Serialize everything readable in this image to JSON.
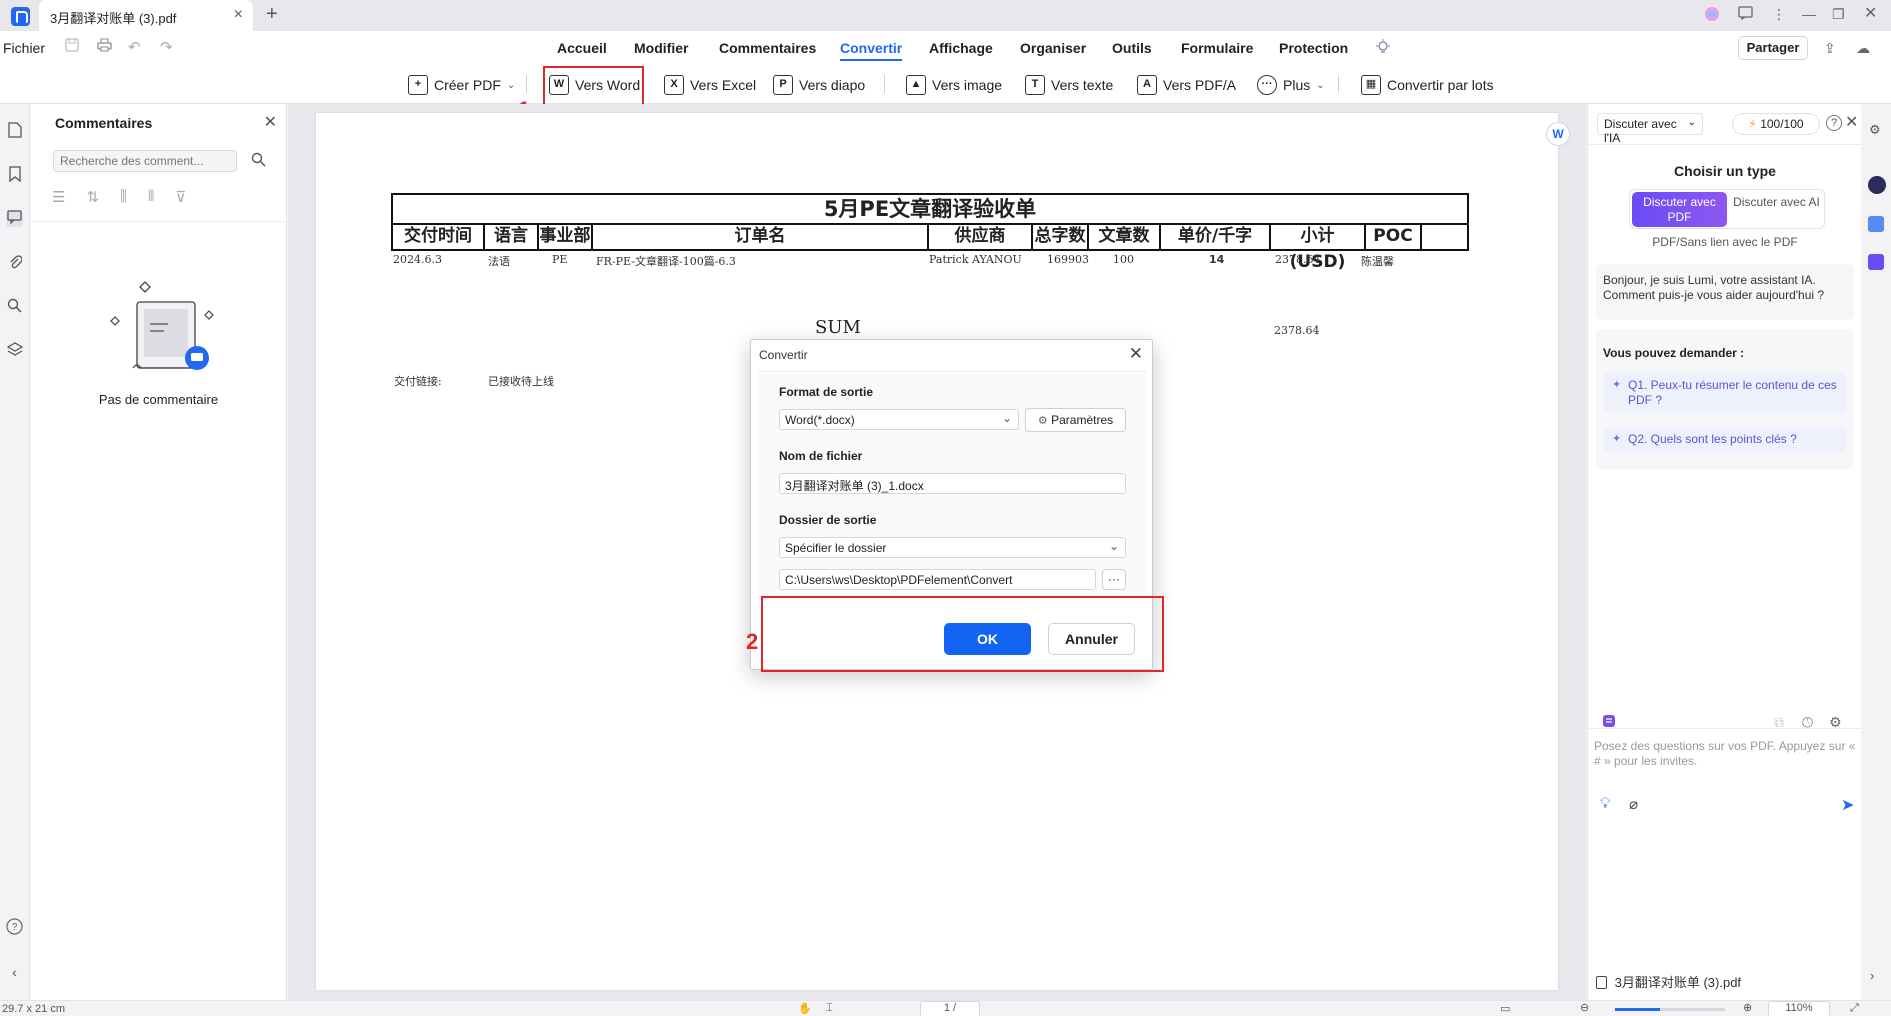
{
  "tabbar": {
    "doc_title": "3月翻译对账单 (3).pdf",
    "close_glyph": "×",
    "add_glyph": "+"
  },
  "menu": {
    "file": "Fichier",
    "items": [
      "Accueil",
      "Modifier",
      "Commentaires",
      "Convertir",
      "Affichage",
      "Organiser",
      "Outils",
      "Formulaire",
      "Protection"
    ],
    "active": "Convertir",
    "share": "Partager"
  },
  "toolbar": {
    "create_pdf": "Créer PDF",
    "to_word": "Vers Word",
    "to_excel": "Vers Excel",
    "to_slides": "Vers diapo",
    "to_image": "Vers image",
    "to_text": "Vers texte",
    "to_pdfa": "Vers PDF/A",
    "more": "Plus",
    "batch": "Convertir par lots"
  },
  "annotations": {
    "step1": "1",
    "step2": "2",
    "color": "#e0262b"
  },
  "comments_panel": {
    "title": "Commentaires",
    "search_placeholder": "Recherche des comment...",
    "empty_text": "Pas de commentaire"
  },
  "document": {
    "title": "5月PE文章翻译验收单",
    "headers": [
      "交付时间",
      "语言",
      "事业部",
      "订单名",
      "供应商",
      "总字数",
      "文章数",
      "单价/千字",
      "小计 (USD)",
      "POC",
      ""
    ],
    "row": [
      "2024.6.3",
      "法语",
      "PE",
      "FR-PE-文章翻译-100篇-6.3",
      "Patrick AYANOU",
      "169903",
      "100",
      "14",
      "2378.64",
      "陈温馨"
    ],
    "sum_label": "SUM",
    "sum_value": "2378.64",
    "footer_label": "交付链接:",
    "footer_value": "已接收待上线"
  },
  "dialog": {
    "title": "Convertir",
    "format_label": "Format de sortie",
    "format_value": "Word(*.docx)",
    "settings_button": "Paramètres",
    "filename_label": "Nom de fichier",
    "filename_value": "3月翻译对账单 (3)_1.docx",
    "folder_label": "Dossier de sortie",
    "folder_value": "Spécifier le dossier",
    "path_value": "C:\\Users\\ws\\Desktop\\PDFelement\\Convert",
    "browse_glyph": "···",
    "ok": "OK",
    "cancel": "Annuler"
  },
  "ai_panel": {
    "mode": "Discuter avec l'IA",
    "credits": "100/100",
    "help_glyph": "?",
    "choose_type": "Choisir un type",
    "choice_pdf": "Discuter avec PDF",
    "choice_ai": "Discuter avec AI",
    "sub": "PDF/Sans lien avec le PDF",
    "greeting": "Bonjour, je suis Lumi, votre assistant IA. Comment puis-je vous aider aujourd'hui ?",
    "suggest_title": "Vous pouvez demander :",
    "q1": "Q1. Peux-tu résumer le contenu de ces PDF ?",
    "q2": "Q2. Quels sont les points clés ?",
    "input_placeholder": "Posez des questions sur vos PDF. Appuyez sur « # » pour les invites.",
    "file_name": "3月翻译对账单 (3).pdf"
  },
  "status": {
    "page_size": "29.7 x 21 cm",
    "page_num": "1 /",
    "zoom": "110%"
  }
}
